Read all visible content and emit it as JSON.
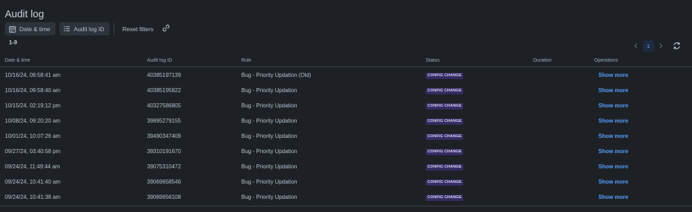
{
  "page": {
    "title": "Audit log"
  },
  "toolbar": {
    "date_time": "Date & time",
    "audit_log_id": "Audit log ID",
    "reset_filters": "Reset filters"
  },
  "results": {
    "range": "1-9"
  },
  "pagination": {
    "current_page": "1"
  },
  "table": {
    "columns": [
      "Date & time",
      "Audit log ID",
      "Rule",
      "Status",
      "Duration",
      "Operations"
    ],
    "rows": [
      {
        "date": "10/16/24, 09:58:41 am",
        "id": "40385197139",
        "rule": "Bug - Priority Updation (Old)",
        "status": "CONFIG CHANGE",
        "duration": "",
        "operation": "Show more"
      },
      {
        "date": "10/16/24, 09:58:40 am",
        "id": "40385195822",
        "rule": "Bug - Priority Updation",
        "status": "CONFIG CHANGE",
        "duration": "",
        "operation": "Show more"
      },
      {
        "date": "10/15/24, 02:19:12 pm",
        "id": "40327586805",
        "rule": "Bug - Priority Updation",
        "status": "CONFIG CHANGE",
        "duration": "",
        "operation": "Show more"
      },
      {
        "date": "10/08/24, 09:20:20 am",
        "id": "39895279155",
        "rule": "Bug - Priority Updation",
        "status": "CONFIG CHANGE",
        "duration": "",
        "operation": "Show more"
      },
      {
        "date": "10/01/24, 10:07:26 am",
        "id": "39490347409",
        "rule": "Bug - Priority Updation",
        "status": "CONFIG CHANGE",
        "duration": "",
        "operation": "Show more"
      },
      {
        "date": "09/27/24, 03:40:58 pm",
        "id": "39310191670",
        "rule": "Bug - Priority Updation",
        "status": "CONFIG CHANGE",
        "duration": "",
        "operation": "Show more"
      },
      {
        "date": "09/24/24, 11:49:44 am",
        "id": "39075310472",
        "rule": "Bug - Priority Updation",
        "status": "CONFIG CHANGE",
        "duration": "",
        "operation": "Show more"
      },
      {
        "date": "09/24/24, 10:41:40 am",
        "id": "39069658546",
        "rule": "Bug - Priority Updation",
        "status": "CONFIG CHANGE",
        "duration": "",
        "operation": "Show more"
      },
      {
        "date": "09/24/24, 10:41:38 am",
        "id": "39069656108",
        "rule": "Bug - Priority Updation",
        "status": "CONFIG CHANGE",
        "duration": "",
        "operation": "Show more"
      }
    ]
  },
  "colors": {
    "background": "#1d2125",
    "text": "#b6c2cf",
    "link": "#579dff",
    "badge_bg": "#352c63",
    "badge_text": "#dfd8fd"
  },
  "icons": {
    "date_filter": "calendar-icon",
    "id_filter": "list-icon",
    "copy_link": "link-icon",
    "prev_page": "chevron-left-icon",
    "next_page": "chevron-right-icon",
    "refresh": "refresh-icon"
  }
}
